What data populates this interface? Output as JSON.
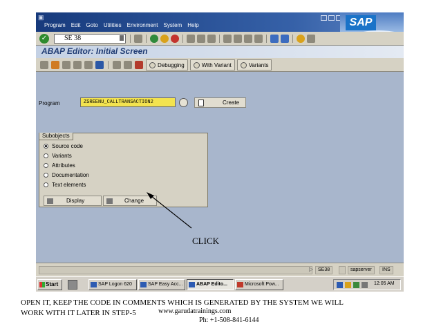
{
  "menubar": {
    "items": [
      "Program",
      "Edit",
      "Goto",
      "Utilities",
      "Environment",
      "System",
      "Help"
    ],
    "underline": [
      "P",
      "E",
      "G",
      "",
      "",
      "S",
      "H"
    ]
  },
  "logo": {
    "text": "SAP"
  },
  "standard_toolbar": {
    "command_field": "SE 38"
  },
  "title": "ABAP Editor: Initial Screen",
  "app_toolbar": {
    "buttons": [
      "Debugging",
      "With Variant",
      "Variants"
    ]
  },
  "program_field": {
    "label": "Program",
    "value": "ZSREENU_CALLTRANSACTION2"
  },
  "create_button": {
    "label": "Create"
  },
  "subobjects": {
    "title": "Subobjects",
    "options": [
      "Source code",
      "Variants",
      "Attributes",
      "Documentation",
      "Text elements"
    ],
    "selected": "Source code",
    "display_label": "Display",
    "change_label": "Change"
  },
  "statusbar": {
    "transaction": "SE38",
    "server": "sapserver",
    "mode": "INS"
  },
  "taskbar": {
    "start": "Start",
    "tasks": [
      "SAP Logon 620",
      "SAP Easy Acc...",
      "ABAP Edito...",
      "Microsoft Pow..."
    ],
    "active_task": "ABAP Edito...",
    "clock": "12:05 AM"
  },
  "annotation": {
    "click_label": "CLICK"
  },
  "caption": {
    "line1": "OPEN IT, KEEP THE CODE IN COMMENTS WHICH IS GENERATED BY THE SYSTEM WE WILL",
    "line2": "WORK WITH IT LATER IN STEP-5",
    "website": "www.garudatrainings.com",
    "phone": "Ph: +1-508-841-6144"
  },
  "colors": {
    "program_field_bg": "#f3e34f",
    "screen_bg": "#a8b6cc",
    "menubar_bg": "#173a7c"
  }
}
